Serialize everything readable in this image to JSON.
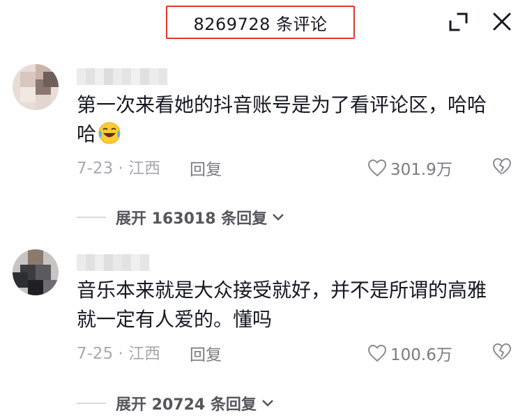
{
  "header": {
    "comment_count_title": "8269728 条评论",
    "expand_icon": "expand-icon",
    "close_icon": "close-icon"
  },
  "comments": [
    {
      "text": "第一次来看她的抖音账号是为了看评论区，哈哈哈",
      "emoji": "laughing-crying-emoji",
      "date_location": "7-23 · 江西",
      "reply_label": "回复",
      "likes": "301.9万",
      "expand_replies": "展开 163018 条回复"
    },
    {
      "text": "音乐本来就是大众接受就好，并不是所谓的高雅就一定有人爱的。懂吗",
      "date_location": "7-25 · 江西",
      "reply_label": "回复",
      "likes": "100.6万",
      "expand_replies": "展开 20724 条回复"
    }
  ],
  "colors": {
    "highlight_border": "#e0382c",
    "text_primary": "#161823",
    "text_secondary": "#a8a9ad",
    "text_action": "#7a7b80"
  }
}
